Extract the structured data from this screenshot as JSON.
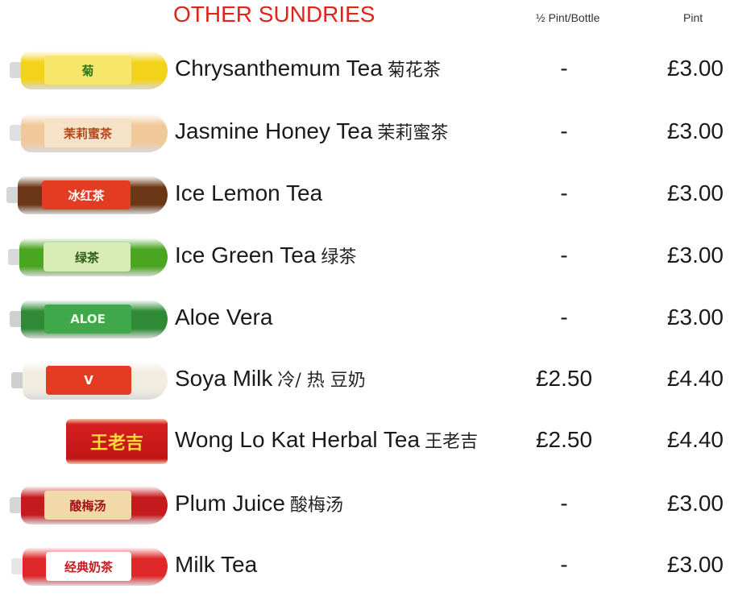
{
  "header": {
    "title": "OTHER SUNDRIES",
    "col_half": "½ Pint/Bottle",
    "col_pint": "Pint"
  },
  "items": [
    {
      "name": "Chrysanthemum Tea",
      "cn": "菊花茶",
      "half": "-",
      "pint": "£3.00",
      "label": "菊",
      "colors": {
        "cap": "#d9d9d9",
        "body": "#f3d21a",
        "label": "#f7e66a",
        "text": "#2d7a1e"
      }
    },
    {
      "name": "Jasmine Honey Tea",
      "cn": "茉莉蜜茶",
      "half": "-",
      "pint": "£3.00",
      "label": "茉莉蜜茶",
      "colors": {
        "cap": "#e0e0e0",
        "body": "#f1c89a",
        "label": "#f6e2c6",
        "text": "#b04a1d"
      }
    },
    {
      "name": "Ice Lemon Tea",
      "cn": "",
      "half": "-",
      "pint": "£3.00",
      "label": "冰红茶",
      "colors": {
        "cap": "#d6d6d6",
        "body": "#6b3717",
        "label": "#e43c22",
        "text": "#ffffff"
      }
    },
    {
      "name": "Ice Green Tea",
      "cn": "绿茶",
      "half": "-",
      "pint": "£3.00",
      "label": "绿茶",
      "colors": {
        "cap": "#d9d9d9",
        "body": "#4aa521",
        "label": "#d9ecb6",
        "text": "#2b5d13"
      }
    },
    {
      "name": "Aloe Vera",
      "cn": "",
      "half": "-",
      "pint": "£3.00",
      "label": "ALOE",
      "colors": {
        "cap": "#d0d0d0",
        "body": "#2f8a36",
        "label": "#3fa84a",
        "text": "#e8ffe6"
      }
    },
    {
      "name": "Soya Milk",
      "cn": "冷/ 热 豆奶",
      "half": "£2.50",
      "pint": "£4.40",
      "label": "V",
      "colors": {
        "cap": "#cfcfcf",
        "body": "#f1ece0",
        "label": "#e43c22",
        "text": "#ffffff"
      }
    },
    {
      "name": "Wong Lo Kat Herbal Tea",
      "cn": "王老吉",
      "half": "£2.50",
      "pint": "£4.40",
      "label": "王老吉",
      "colors": {
        "cap": "#cccccc",
        "body": "#c8161e",
        "label": "#c8161e",
        "text": "#ffd93a"
      }
    },
    {
      "name": "Plum Juice",
      "cn": "酸梅汤",
      "half": "-",
      "pint": "£3.00",
      "label": "酸梅汤",
      "colors": {
        "cap": "#d6d6d6",
        "body": "#c51a1e",
        "label": "#f1d9a8",
        "text": "#a3121a"
      }
    },
    {
      "name": "Milk Tea",
      "cn": "",
      "half": "-",
      "pint": "£3.00",
      "label": "经典奶茶",
      "colors": {
        "cap": "#e6e6e6",
        "body": "#e0282a",
        "label": "#ffffff",
        "text": "#c91a1e"
      }
    }
  ]
}
